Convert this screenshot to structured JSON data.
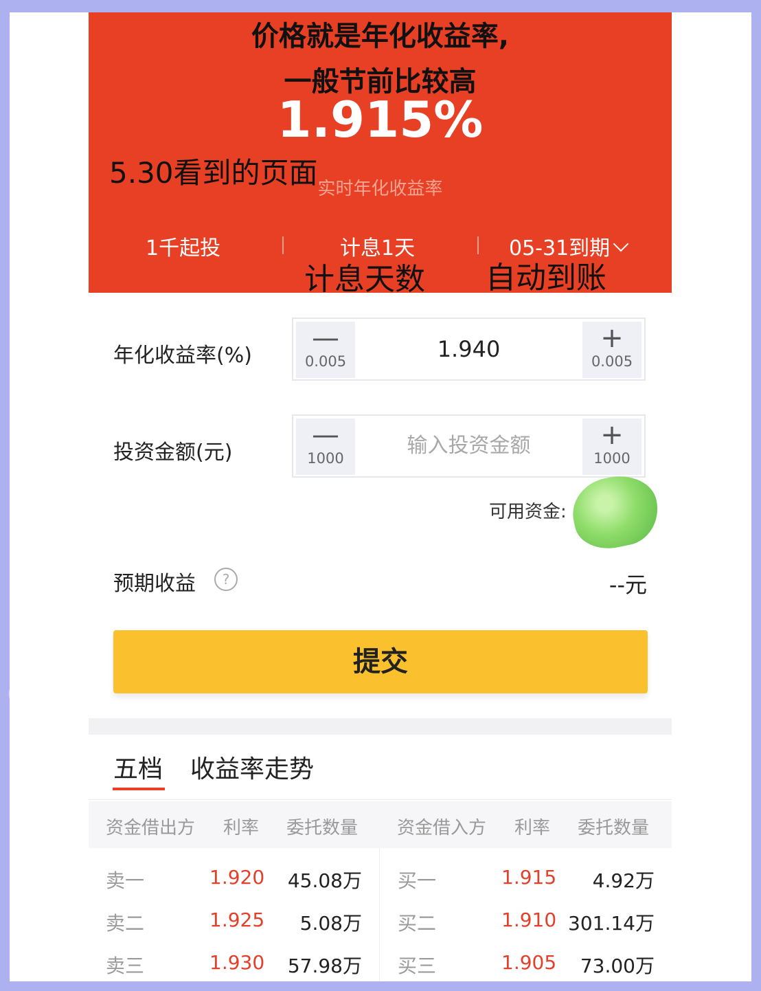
{
  "annotations": {
    "line1": "价格就是年化收益率,",
    "line2": "一般节前比较高",
    "date_note": "5.30看到的页面",
    "interest_days_note": "计息天数",
    "auto_arrival_note": "自动到账"
  },
  "banner": {
    "rate": "1.915%",
    "rate_caption": "实时年化收益率",
    "min_invest": "1千起投",
    "interest": "计息1天",
    "maturity": "05-31到期"
  },
  "form": {
    "rate_label": "年化收益率(%)",
    "rate_value": "1.940",
    "rate_step": "0.005",
    "amount_label": "投资金额(元)",
    "amount_placeholder": "输入投资金额",
    "amount_step": "1000",
    "available_funds": "可用资金:",
    "expected_label": "预期收益",
    "expected_value": "--元",
    "submit": "提交"
  },
  "tabs": [
    "五档",
    "收益率走势"
  ],
  "orderbook": {
    "headers": [
      "资金借出方",
      "利率",
      "委托数量",
      "资金借入方",
      "利率",
      "委托数量"
    ],
    "rows": [
      {
        "sell_name": "卖一",
        "sell_rate": "1.920",
        "sell_qty": "45.08万",
        "buy_name": "买一",
        "buy_rate": "1.915",
        "buy_qty": "4.92万"
      },
      {
        "sell_name": "卖二",
        "sell_rate": "1.925",
        "sell_qty": "5.08万",
        "buy_name": "买二",
        "buy_rate": "1.910",
        "buy_qty": "301.14万"
      },
      {
        "sell_name": "卖三",
        "sell_rate": "1.930",
        "sell_qty": "57.98万",
        "buy_name": "买三",
        "buy_rate": "1.905",
        "buy_qty": "73.00万"
      }
    ]
  },
  "colors": {
    "banner": "#e84025",
    "submit": "#fbc02d",
    "rate_red": "#e3402b"
  }
}
